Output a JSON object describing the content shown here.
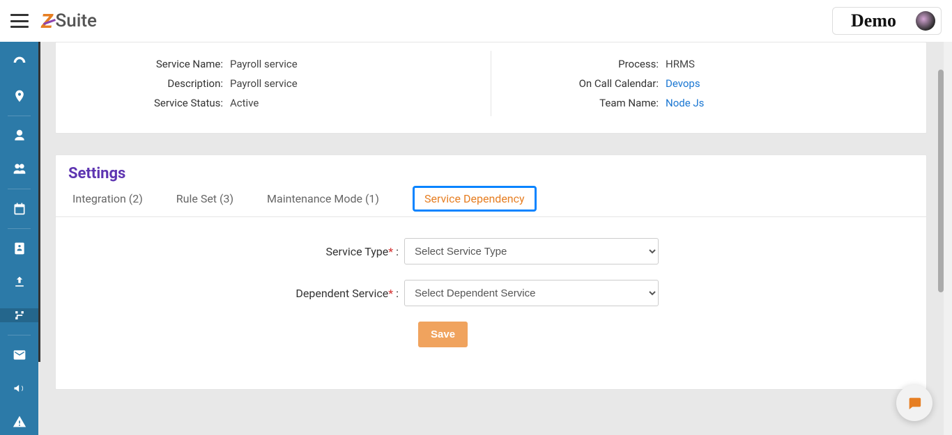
{
  "header": {
    "brand_suffix": "Suite",
    "demo_label": "Demo"
  },
  "details": {
    "left": [
      {
        "label": "Service Name:",
        "value": "Payroll service",
        "link": false
      },
      {
        "label": "Description:",
        "value": "Payroll service",
        "link": false
      },
      {
        "label": "Service Status:",
        "value": "Active",
        "link": false
      }
    ],
    "right": [
      {
        "label": "Process:",
        "value": "HRMS",
        "link": false
      },
      {
        "label": "On Call Calendar:",
        "value": "Devops",
        "link": true
      },
      {
        "label": "Team Name:",
        "value": "Node Js",
        "link": true
      }
    ]
  },
  "settings": {
    "title": "Settings",
    "tabs": {
      "integration": "Integration (2)",
      "ruleset": "Rule Set (3)",
      "maintenance": "Maintenance Mode (1)",
      "dependency": "Service Dependency"
    },
    "form": {
      "service_type_label": "Service Type",
      "service_type_placeholder": "Select Service Type",
      "dependent_service_label": "Dependent Service",
      "dependent_service_placeholder": "Select Dependent Service",
      "colon": " :",
      "save": "Save"
    }
  }
}
